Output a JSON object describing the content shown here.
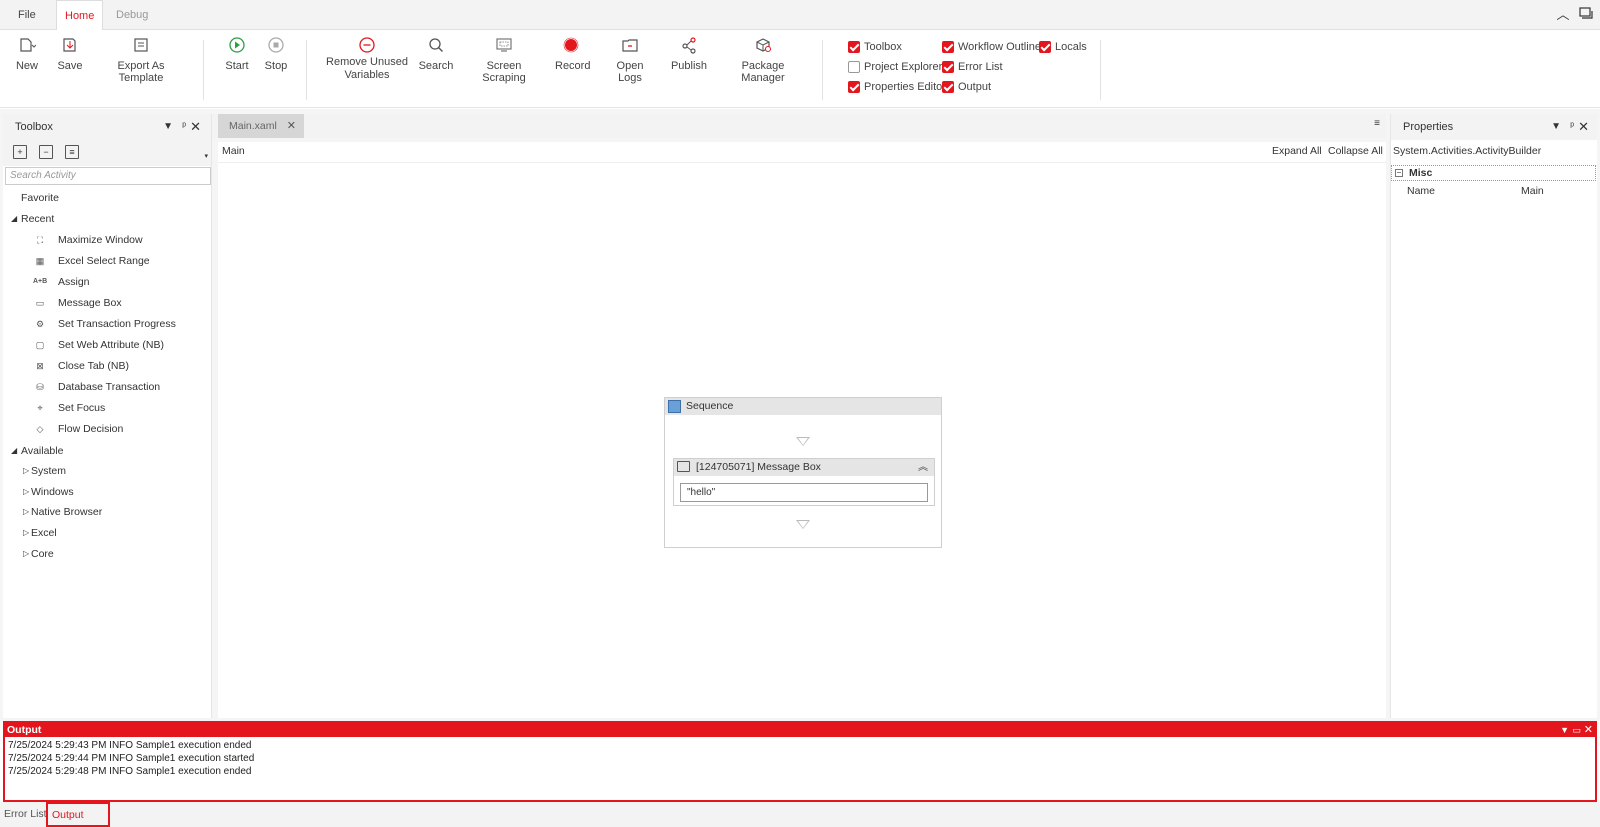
{
  "menu": {
    "tabs": [
      {
        "label": "File"
      },
      {
        "label": "Home"
      },
      {
        "label": "Debug"
      }
    ]
  },
  "ribbon": {
    "buttons": [
      {
        "label": "New",
        "icon": "new-file-icon"
      },
      {
        "label": "Save",
        "icon": "save-icon"
      },
      {
        "label": "Export As Template",
        "icon": "export-template-icon"
      },
      {
        "label": "Start",
        "icon": "play-icon"
      },
      {
        "label": "Stop",
        "icon": "stop-icon"
      },
      {
        "label": "Remove Unused Variables",
        "label_line1": "Remove Unused",
        "label_line2": "Variables",
        "icon": "remove-icon"
      },
      {
        "label": "Search",
        "icon": "search-icon"
      },
      {
        "label": "Screen Scraping",
        "icon": "screen-scraping-icon"
      },
      {
        "label": "Record",
        "icon": "record-icon"
      },
      {
        "label": "Open Logs",
        "icon": "open-logs-icon"
      },
      {
        "label": "Publish",
        "icon": "publish-icon"
      },
      {
        "label": "Package Manager",
        "icon": "package-manager-icon"
      }
    ],
    "panels_toggles": [
      {
        "label": "Toolbox",
        "checked": true
      },
      {
        "label": "Project Explorer",
        "checked": false
      },
      {
        "label": "Properties Editor",
        "checked": true
      },
      {
        "label": "Workflow Outline",
        "checked": true
      },
      {
        "label": "Error List",
        "checked": true
      },
      {
        "label": "Output",
        "checked": true
      },
      {
        "label": "Locals",
        "checked": true
      }
    ]
  },
  "toolbox": {
    "title": "Toolbox",
    "search_placeholder": "Search Activity",
    "favorite": "Favorite",
    "recent_label": "Recent",
    "recent": [
      {
        "label": "Maximize Window",
        "icon": "maximize-window-icon"
      },
      {
        "label": "Excel Select Range",
        "icon": "excel-range-icon"
      },
      {
        "label": "Assign",
        "icon": "assign-icon"
      },
      {
        "label": "Message Box",
        "icon": "message-box-icon"
      },
      {
        "label": "Set Transaction Progress",
        "icon": "transaction-progress-icon"
      },
      {
        "label": "Set Web Attribute (NB)",
        "icon": "web-attribute-icon"
      },
      {
        "label": "Close Tab (NB)",
        "icon": "close-tab-icon"
      },
      {
        "label": "Database Transaction",
        "icon": "database-icon"
      },
      {
        "label": "Set Focus",
        "icon": "set-focus-icon"
      },
      {
        "label": "Flow Decision",
        "icon": "flow-decision-icon"
      }
    ],
    "available_label": "Available",
    "available": [
      {
        "label": "System"
      },
      {
        "label": "Windows"
      },
      {
        "label": "Native Browser"
      },
      {
        "label": "Excel"
      },
      {
        "label": "Core"
      }
    ]
  },
  "document": {
    "tab_label": "Main.xaml",
    "breadcrumb": "Main",
    "expand_all": "Expand All",
    "collapse_all": "Collapse All"
  },
  "workflow": {
    "sequence_title": "Sequence",
    "activity_title": "[124705071] Message Box",
    "activity_value": "\"hello\""
  },
  "properties": {
    "title": "Properties",
    "type_name": "System.Activities.ActivityBuilder",
    "category": "Misc",
    "rows": [
      {
        "name": "Name",
        "value": "Main"
      }
    ]
  },
  "output": {
    "title": "Output",
    "logs": [
      "7/25/2024 5:29:43 PM INFO Sample1 execution ended",
      "7/25/2024 5:29:44 PM INFO Sample1 execution started",
      "7/25/2024 5:29:48 PM INFO Sample1 execution ended"
    ]
  },
  "bottom_tabs": [
    {
      "label": "Error List"
    },
    {
      "label": "Output"
    }
  ],
  "colors": {
    "accent": "#e3161e",
    "start_green": "#2e9e44",
    "panel_bg": "#f3f3f3"
  }
}
